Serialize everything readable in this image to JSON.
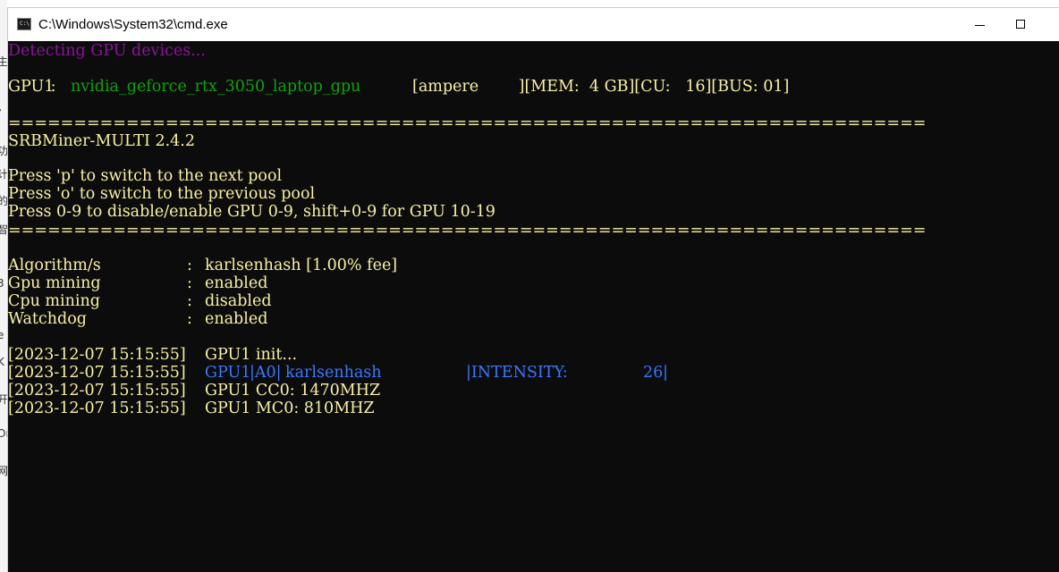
{
  "window": {
    "title": "C:\\Windows\\System32\\cmd.exe",
    "icon_label": "C:\\"
  },
  "background_fragments": [
    "主",
    "/",
    "功",
    "计",
    "的",
    "智",
    "3",
    "e",
    "K",
    "开",
    "Or",
    "网"
  ],
  "console": {
    "detecting": "Detecting GPU devices...",
    "gpu_line": {
      "id": "GPU1",
      "sep": " : ",
      "name": "nvidia_geforce_rtx_3050_laptop_gpu",
      "arch": "[ampere        ][MEM:  4 GB][CU:   16][BUS: 01]"
    },
    "rule1": "======================================================================",
    "version": "SRBMiner-MULTI 2.4.2",
    "help": [
      "Press 'p' to switch to the next pool",
      "Press 'o' to switch to the previous pool",
      "Press 0-9 to disable/enable GPU 0-9, shift+0-9 for GPU 10-19"
    ],
    "rule2": "======================================================================",
    "settings": [
      {
        "key": "Algorithm/s         ",
        "sep": ": ",
        "value": "karlsenhash [1.00% fee]"
      },
      {
        "key": "Gpu mining          ",
        "sep": ": ",
        "value": "enabled"
      },
      {
        "key": "Cpu mining          ",
        "sep": ": ",
        "value": "disabled"
      },
      {
        "key": "Watchdog            ",
        "sep": ": ",
        "value": "enabled"
      }
    ],
    "log": {
      "ts": "[2023-12-07 15:15:55]",
      "init": "GPU1 init...",
      "intensity_gpu": "GPU1 ",
      "intensity_a": "|A0|",
      "intensity_algo": "karlsenhash         ",
      "intensity_label": "|INTENSITY:         ",
      "intensity_value": "26",
      "intensity_end": "|",
      "cc0": "GPU1 CC0: 1470MHZ",
      "mc0": "GPU1 MC0: 810MHZ"
    }
  },
  "colors": {
    "console_bg": "#0c0c0c",
    "magenta": "#881798",
    "green": "#13a10e",
    "cream": "#f9f1a5",
    "blue": "#3b78ff"
  }
}
